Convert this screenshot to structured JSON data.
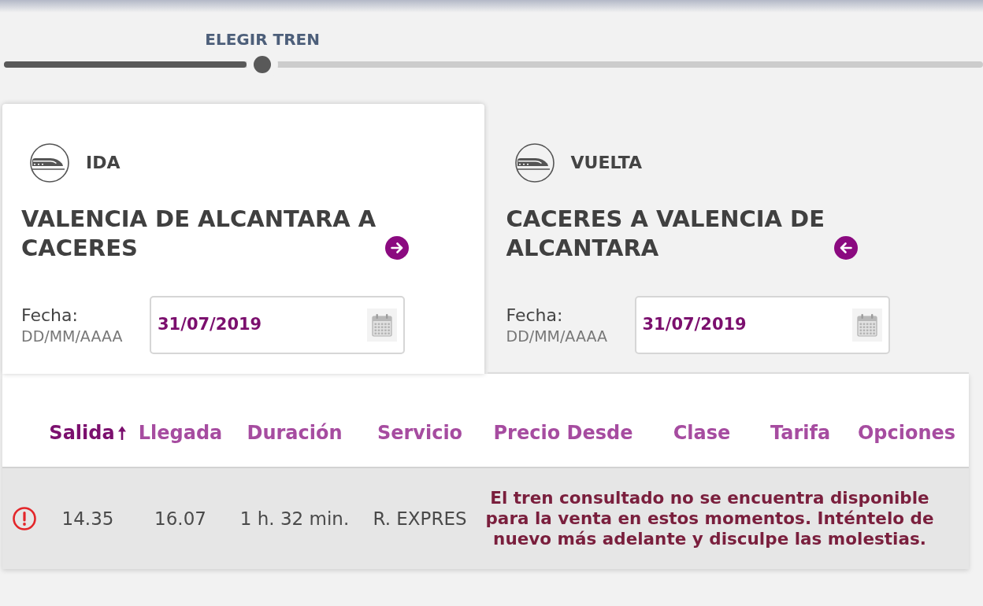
{
  "stepper": {
    "label": "ELEGIR TREN",
    "level": 0.264
  },
  "tabs": [
    {
      "kind": "outbound",
      "label": "IDA",
      "selected": true,
      "route": "VALENCIA DE ALCANTARA A CACERES",
      "date_label": "Fecha:",
      "date_format": "DD/MM/AAAA",
      "date_value": "31/07/2019"
    },
    {
      "kind": "return",
      "label": "VUELTA",
      "selected": false,
      "route": "CACERES A VALENCIA DE ALCANTARA",
      "date_label": "Fecha:",
      "date_format": "DD/MM/AAAA",
      "date_value": "31/07/2019"
    }
  ],
  "table": {
    "columns": [
      {
        "label": "Salida",
        "sorted": true
      },
      {
        "label": "Llegada",
        "sorted": false
      },
      {
        "label": "Duración",
        "sorted": false
      },
      {
        "label": "Servicio",
        "sorted": false
      },
      {
        "label": "Precio Desde",
        "sorted": false
      },
      {
        "label": "Clase",
        "sorted": false
      },
      {
        "label": "Tarifa",
        "sorted": false
      },
      {
        "label": "Opciones",
        "sorted": false
      }
    ],
    "rows": [
      {
        "kind": "unavailable",
        "departure": "14.35",
        "arrival": "16.07",
        "duration": "1 h. 32 min.",
        "service": "R. EXPRES",
        "message": "El tren consultado no se encuentra disponible para la venta en estos momentos. Inténtelo de nuevo más adelante y disculpe las molestias."
      }
    ]
  }
}
